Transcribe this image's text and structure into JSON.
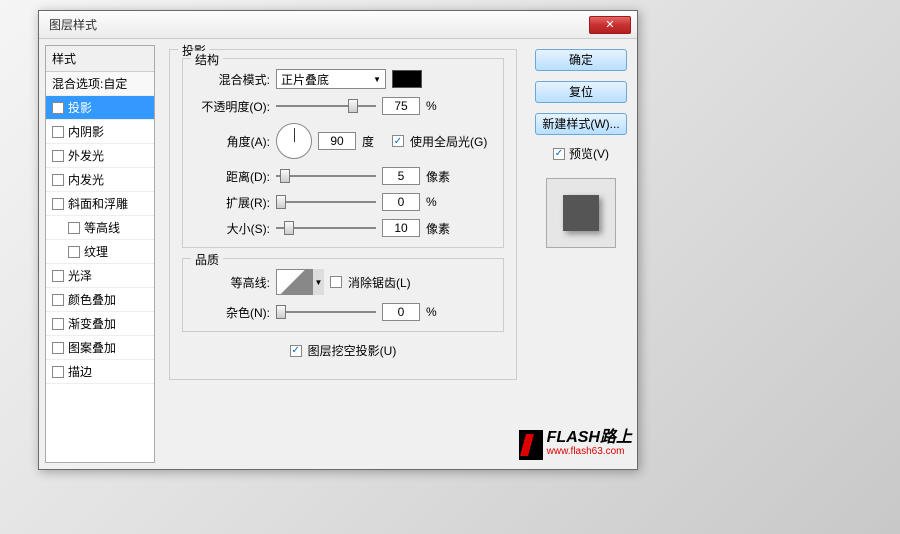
{
  "dialog": {
    "title": "图层样式"
  },
  "sidebar": {
    "header": "样式",
    "blend": "混合选项:自定",
    "items": [
      {
        "label": "投影",
        "checked": true,
        "selected": true
      },
      {
        "label": "内阴影",
        "checked": false
      },
      {
        "label": "外发光",
        "checked": false
      },
      {
        "label": "内发光",
        "checked": false
      },
      {
        "label": "斜面和浮雕",
        "checked": false
      },
      {
        "label": "等高线",
        "checked": false,
        "indent": true
      },
      {
        "label": "纹理",
        "checked": false,
        "indent": true
      },
      {
        "label": "光泽",
        "checked": false
      },
      {
        "label": "颜色叠加",
        "checked": false
      },
      {
        "label": "渐变叠加",
        "checked": false
      },
      {
        "label": "图案叠加",
        "checked": false
      },
      {
        "label": "描边",
        "checked": false
      }
    ]
  },
  "main": {
    "title": "投影",
    "structure": {
      "title": "结构",
      "blend_mode_label": "混合模式:",
      "blend_mode_value": "正片叠底",
      "opacity_label": "不透明度(O):",
      "opacity_value": "75",
      "opacity_unit": "%",
      "angle_label": "角度(A):",
      "angle_value": "90",
      "angle_unit": "度",
      "global_light_label": "使用全局光(G)",
      "distance_label": "距离(D):",
      "distance_value": "5",
      "distance_unit": "像素",
      "spread_label": "扩展(R):",
      "spread_value": "0",
      "spread_unit": "%",
      "size_label": "大小(S):",
      "size_value": "10",
      "size_unit": "像素"
    },
    "quality": {
      "title": "品质",
      "contour_label": "等高线:",
      "antialias_label": "消除锯齿(L)",
      "noise_label": "杂色(N):",
      "noise_value": "0",
      "noise_unit": "%"
    },
    "knockout_label": "图层挖空投影(U)"
  },
  "buttons": {
    "ok": "确定",
    "cancel": "复位",
    "new_style": "新建样式(W)...",
    "preview": "预览(V)"
  },
  "watermark": {
    "text": "FLASH路上",
    "url": "www.flash63.com"
  }
}
